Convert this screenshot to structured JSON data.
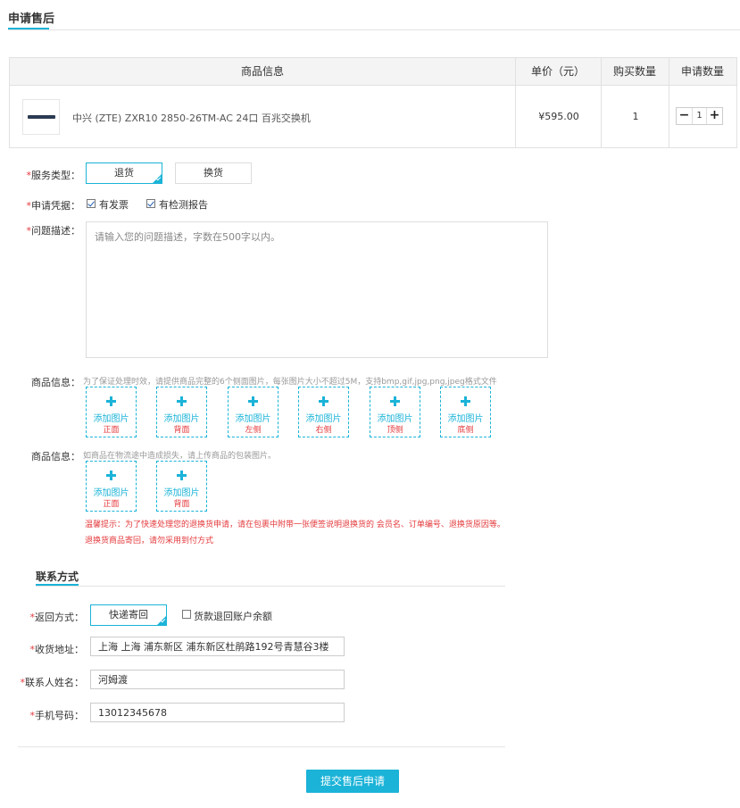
{
  "header": {
    "title": "申请售后"
  },
  "product_table": {
    "col_info": "商品信息",
    "col_price": "单价（元）",
    "col_buy_qty": "购买数量",
    "col_apply_qty": "申请数量",
    "row": {
      "name": "中兴 (ZTE) ZXR10 2850-26TM-AC 24口 百兆交换机",
      "price": "¥595.00",
      "buy_qty": "1",
      "apply_qty": "1",
      "minus": "−",
      "plus": "+"
    }
  },
  "service_type": {
    "required_mark": "*",
    "label": "服务类型：",
    "options": [
      {
        "label": "退货",
        "selected": true
      },
      {
        "label": "换货",
        "selected": false
      }
    ]
  },
  "evidence": {
    "required_mark": "*",
    "label": "申请凭据：",
    "items": [
      {
        "label": "有发票",
        "checked": true
      },
      {
        "label": "有检测报告",
        "checked": true
      }
    ]
  },
  "problem": {
    "required_mark": "*",
    "label": "问题描述：",
    "placeholder": "请输入您的问题描述，字数在500字以内。"
  },
  "product_photos": {
    "label": "商品信息：",
    "hint": "为了保证处理时效，请提供商品完整的6个侧面图片，每张图片大小不超过5M，支持bmp,gif,jpg,png,jpeg格式文件",
    "add_text": "添加图片",
    "slots": [
      "正面",
      "背面",
      "左侧",
      "右侧",
      "顶侧",
      "底侧"
    ]
  },
  "package_photos": {
    "label": "商品信息：",
    "hint": "如商品在物流途中造成损失，请上传商品的包装图片。",
    "add_text": "添加图片",
    "slots": [
      "正面",
      "背面"
    ]
  },
  "warning": {
    "line1": "温馨提示：为了快速处理您的退换货申请，请在包裹中附带一张便签说明退换货的 会员名、订单编号、退换货原因等。",
    "line2": "退换货商品寄回，请勿采用到付方式"
  },
  "contact": {
    "section_title": "联系方式",
    "return_method": {
      "required_mark": "*",
      "label": "返回方式：",
      "option": "快递寄回",
      "refund_checkbox_label": "货款退回账户余额",
      "refund_checked": false
    },
    "address": {
      "required_mark": "*",
      "label": "收货地址：",
      "value": "上海 上海 浦东新区 浦东新区杜鹃路192号青慧谷3楼"
    },
    "name": {
      "required_mark": "*",
      "label": "联系人姓名：",
      "value": "河姆渡"
    },
    "phone": {
      "required_mark": "*",
      "label": "手机号码：",
      "value": "13012345678"
    }
  },
  "submit_label": "提交售后申请",
  "colors": {
    "accent": "#1bb3d8",
    "required": "#e4393c"
  }
}
